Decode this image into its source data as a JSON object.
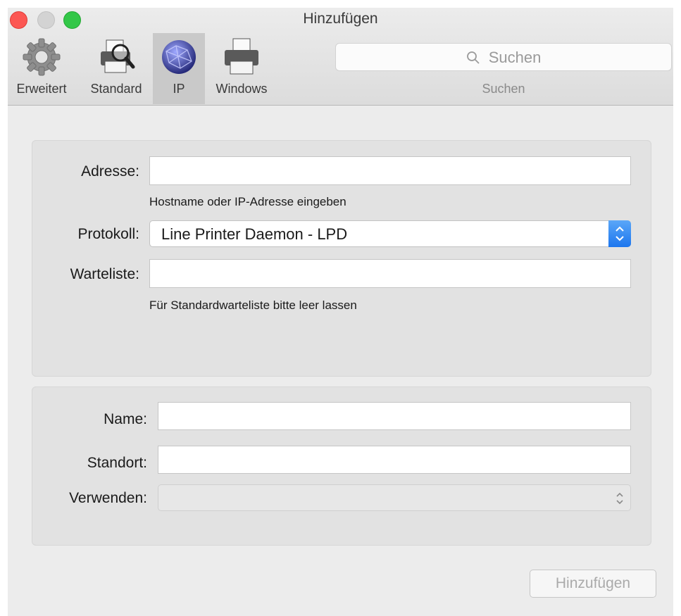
{
  "window": {
    "title": "Hinzufügen"
  },
  "toolbar": {
    "items": [
      {
        "label": "Erweitert",
        "icon": "gear-icon"
      },
      {
        "label": "Standard",
        "icon": "printer-search-icon"
      },
      {
        "label": "IP",
        "icon": "globe-icon",
        "selected": true
      },
      {
        "label": "Windows",
        "icon": "printer-icon"
      }
    ],
    "search": {
      "placeholder": "Suchen",
      "caption": "Suchen",
      "icon": "search-icon"
    }
  },
  "form": {
    "address": {
      "label": "Adresse:",
      "value": "",
      "hint": "Hostname oder IP-Adresse eingeben"
    },
    "protocol": {
      "label": "Protokoll:",
      "selected": "Line Printer Daemon - LPD"
    },
    "queue": {
      "label": "Warteliste:",
      "value": "",
      "hint": "Für Standardwarteliste bitte leer lassen"
    },
    "name": {
      "label": "Name:",
      "value": ""
    },
    "location": {
      "label": "Standort:",
      "value": ""
    },
    "use": {
      "label": "Verwenden:",
      "selected": ""
    }
  },
  "actions": {
    "add_label": "Hinzufügen"
  },
  "colors": {
    "accent": "#1d76ee",
    "close": "#fc5753",
    "zoom": "#33c748"
  }
}
